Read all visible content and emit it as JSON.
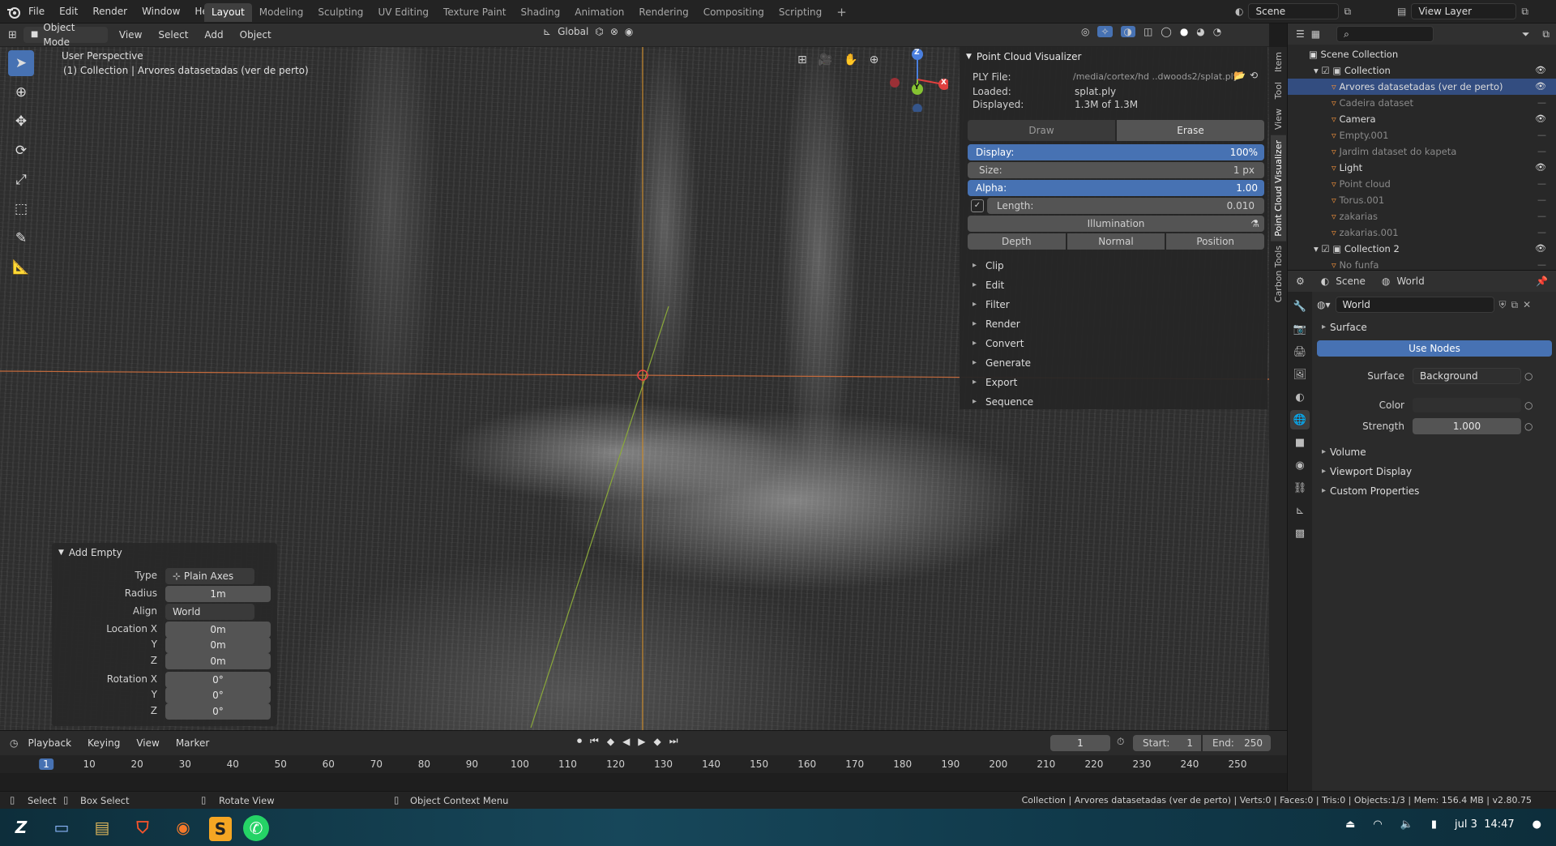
{
  "topbar": {
    "menus": [
      "File",
      "Edit",
      "Render",
      "Window",
      "Help"
    ],
    "workspaces": [
      "Layout",
      "Modeling",
      "Sculpting",
      "UV Editing",
      "Texture Paint",
      "Shading",
      "Animation",
      "Rendering",
      "Compositing",
      "Scripting"
    ],
    "active_workspace": "Layout",
    "add_tab": "+",
    "scene_name": "Scene",
    "view_layer": "View Layer"
  },
  "viewport_header": {
    "mode": "Object Mode",
    "menus": [
      "View",
      "Select",
      "Add",
      "Object"
    ],
    "orientation": "Global"
  },
  "viewport": {
    "perspective": "User Perspective",
    "collection_info": "(1) Collection | Arvores datasetadas (ver de perto)",
    "gizmo": {
      "z": "Z",
      "y": "Y",
      "x": "X"
    },
    "side_tabs": [
      "Item",
      "Tool",
      "View",
      "Point Cloud Visualizer",
      "Carbon Tools"
    ],
    "active_side_tab": "Point Cloud Visualizer"
  },
  "pcv": {
    "title": "Point Cloud Visualizer",
    "ply_label": "PLY File:",
    "ply_value": "/media/cortex/hd ..dwoods2/splat.ply",
    "loaded_label": "Loaded:",
    "loaded_value": "splat.ply",
    "displayed_label": "Displayed:",
    "displayed_value": "1.3M of 1.3M",
    "draw": "Draw",
    "erase": "Erase",
    "display_label": "Display:",
    "display_value": "100%",
    "display_fraction": 1.0,
    "size_label": "Size:",
    "size_value": "1 px",
    "alpha_label": "Alpha:",
    "alpha_value": "1.00",
    "alpha_fraction": 1.0,
    "length_label": "Length:",
    "length_value": "0.010",
    "illumination": "Illumination",
    "modes": [
      "Depth",
      "Normal",
      "Position"
    ],
    "sections": [
      "Clip",
      "Edit",
      "Filter",
      "Render",
      "Convert",
      "Generate",
      "Export",
      "Sequence"
    ]
  },
  "add_empty": {
    "title": "Add Empty",
    "type_label": "Type",
    "type_value": "Plain Axes",
    "radius_label": "Radius",
    "radius_value": "1m",
    "align_label": "Align",
    "align_value": "World",
    "location_label": "Location X",
    "loc_x": "0m",
    "y_label": "Y",
    "loc_y": "0m",
    "z_label": "Z",
    "loc_z": "0m",
    "rotation_label": "Rotation X",
    "rot_x": "0°",
    "rot_y": "0°",
    "rot_z": "0°"
  },
  "outliner": {
    "search_placeholder": "",
    "root": "Scene Collection",
    "items": [
      {
        "label": "Collection",
        "dim": false,
        "sel": false,
        "indent": 1,
        "eye": true
      },
      {
        "label": "Arvores datasetadas (ver de perto)",
        "dim": false,
        "sel": true,
        "indent": 2,
        "eye": true
      },
      {
        "label": "Cadeira dataset",
        "dim": true,
        "sel": false,
        "indent": 2,
        "eye": false
      },
      {
        "label": "Camera",
        "dim": false,
        "sel": false,
        "indent": 2,
        "eye": true
      },
      {
        "label": "Empty.001",
        "dim": true,
        "sel": false,
        "indent": 2,
        "eye": false
      },
      {
        "label": "Jardim dataset do kapeta",
        "dim": true,
        "sel": false,
        "indent": 2,
        "eye": false
      },
      {
        "label": "Light",
        "dim": false,
        "sel": false,
        "indent": 2,
        "eye": true
      },
      {
        "label": "Point cloud",
        "dim": true,
        "sel": false,
        "indent": 2,
        "eye": false
      },
      {
        "label": "Torus.001",
        "dim": true,
        "sel": false,
        "indent": 2,
        "eye": false
      },
      {
        "label": "zakarias",
        "dim": true,
        "sel": false,
        "indent": 2,
        "eye": false
      },
      {
        "label": "zakarias.001",
        "dim": true,
        "sel": false,
        "indent": 2,
        "eye": false
      },
      {
        "label": "Collection 2",
        "dim": false,
        "sel": false,
        "indent": 1,
        "eye": true
      },
      {
        "label": "No funfa",
        "dim": true,
        "sel": false,
        "indent": 2,
        "eye": false
      }
    ]
  },
  "properties": {
    "breadcrumb_scene": "Scene",
    "breadcrumb_world": "World",
    "world_name": "World",
    "surface_header": "Surface",
    "use_nodes": "Use Nodes",
    "surface_label": "Surface",
    "surface_value": "Background",
    "color_label": "Color",
    "strength_label": "Strength",
    "strength_value": "1.000",
    "collapsed": [
      "Volume",
      "Viewport Display",
      "Custom Properties"
    ]
  },
  "timeline": {
    "menus": [
      "Playback",
      "Keying",
      "View",
      "Marker"
    ],
    "current_frame": "1",
    "start_label": "Start:",
    "start_value": "1",
    "end_label": "End:",
    "end_value": "250",
    "ticks": [
      "1",
      "10",
      "20",
      "30",
      "40",
      "50",
      "60",
      "70",
      "80",
      "90",
      "100",
      "110",
      "120",
      "130",
      "140",
      "150",
      "160",
      "170",
      "180",
      "190",
      "200",
      "210",
      "220",
      "230",
      "240",
      "250"
    ]
  },
  "statusbar": {
    "select": "Select",
    "box_select": "Box Select",
    "rotate_view": "Rotate View",
    "context_menu": "Object Context Menu",
    "stats": "Collection | Arvores datasetadas (ver de perto) | Verts:0 | Faces:0 | Tris:0 | Objects:1/3 | Mem: 156.4 MB | v2.80.75"
  },
  "taskbar": {
    "date": "jul 3",
    "time": "14:47"
  },
  "colors": {
    "accent": "#4772b3",
    "selection": "#334d80",
    "x_axis": "#e0403f",
    "y_axis": "#86c332",
    "z_axis": "#4a7fde"
  }
}
